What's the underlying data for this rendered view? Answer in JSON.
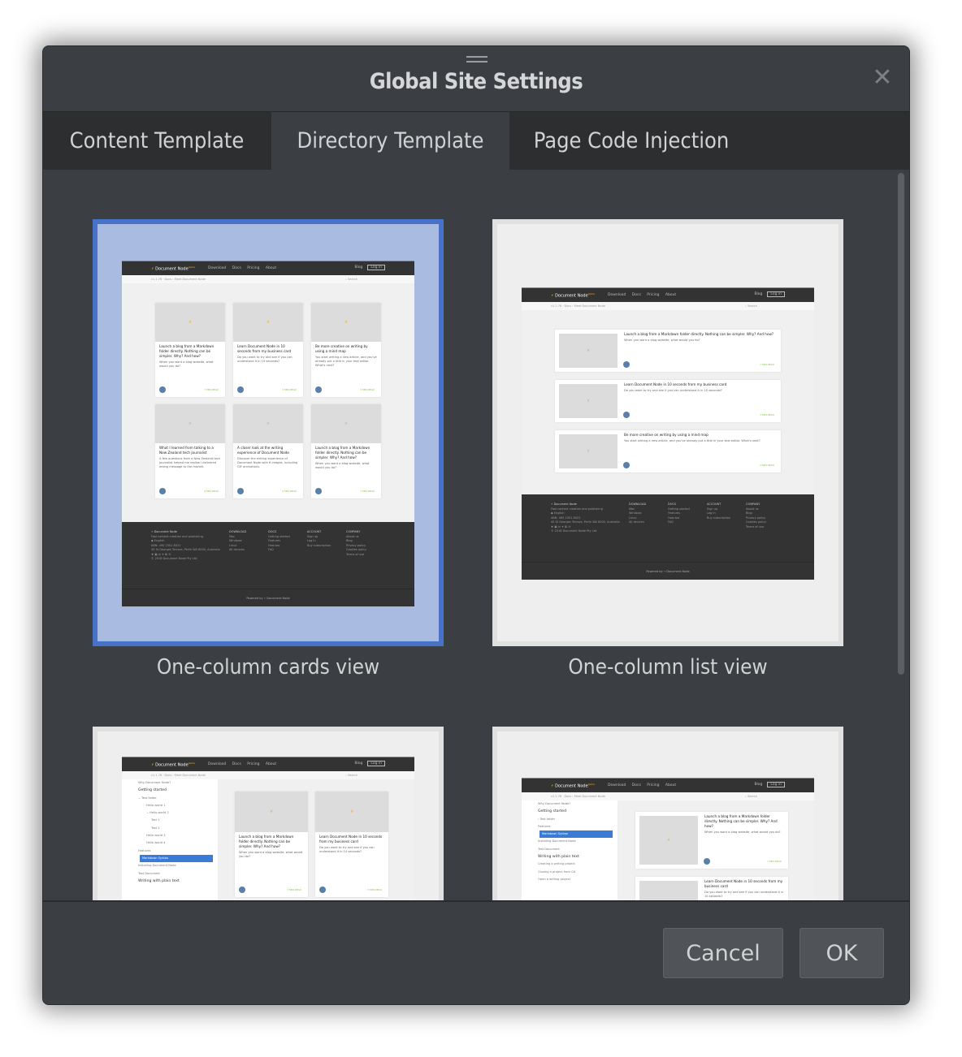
{
  "dialog": {
    "title": "Global Site Settings",
    "close_icon": "close-icon",
    "grip_icon": "drag-handle-icon"
  },
  "tabs": [
    {
      "label": "Content Template",
      "active": false
    },
    {
      "label": "Directory Template",
      "active": true
    },
    {
      "label": "Page Code Injection",
      "active": false
    }
  ],
  "templates": [
    {
      "label": "One-column cards view",
      "selected": true
    },
    {
      "label": "One-column list view",
      "selected": false
    },
    {
      "label": "",
      "selected": false
    },
    {
      "label": "",
      "selected": false
    }
  ],
  "preview": {
    "brand": "Document Node",
    "brand_badge": "alpha",
    "nav_links": [
      "Download",
      "Docs",
      "Pricing",
      "About"
    ],
    "nav_right": [
      "Blog",
      "Log in"
    ],
    "breadcrumb": "v1.1.76 · Docs › Meet Document Node",
    "search_placeholder": "Search",
    "articles": [
      {
        "title": "Launch a blog from a Markdown folder directly. Nothing can be simpler. Why? And how?",
        "desc": "When you want a blog website, what would you do?",
        "read": "7 MIN READ"
      },
      {
        "title": "Learn Document Node in 10 seconds from my business card",
        "desc": "Do you want to try and see if you can understand it in 10 seconds?",
        "read": "3 MIN READ"
      },
      {
        "title": "Be more creative on writing by using a mind map",
        "desc": "You start writing a new article, and you've already put a title in your text editor. What's next?",
        "read": "3 MIN READ"
      },
      {
        "title": "What I learned from talking to a New Zealand tech journalist",
        "desc": "A few questions from a New Zealand tech journalist helped me realize I delivered wrong message to the market.",
        "read": "4 MIN READ"
      },
      {
        "title": "A closer look at the writing experience of Document Node",
        "desc": "Discover the writing experience of Document Node with 6 images, including GIF animations.",
        "read": "2 MIN READ"
      },
      {
        "title": "Launch a blog from a Markdown folder directly. Nothing can be simpler. Why? And how?",
        "desc": "When you want a blog website, what would you do?",
        "read": "7 MIN READ"
      }
    ],
    "footer": {
      "tagline": "Fast content creation and publishing",
      "language": "English",
      "abn": "ABN: 490 2301 8022",
      "address": "45 St Georges Terrace, Perth WA 6000, Australia",
      "copyright": "© 2018 Document Node Pty Ltd",
      "columns": [
        {
          "heading": "DOWNLOAD",
          "items": [
            "Mac",
            "Windows",
            "Linux",
            "All devices"
          ]
        },
        {
          "heading": "DOCS",
          "items": [
            "Getting started",
            "Features",
            "How-tos",
            "FAQ"
          ]
        },
        {
          "heading": "ACCOUNT",
          "items": [
            "Sign up",
            "Log in",
            "Buy subscription"
          ]
        },
        {
          "heading": "COMPANY",
          "items": [
            "About us",
            "Blog",
            "Privacy policy",
            "Cookies policy",
            "Terms of use"
          ]
        }
      ],
      "powered_by": "Powered by",
      "powered_brand": "Document Node"
    },
    "sidebar": [
      {
        "text": "Why Document Node?",
        "type": "item"
      },
      {
        "text": "Getting started",
        "type": "heading"
      },
      {
        "text": "⌄ Test folder",
        "type": "item"
      },
      {
        "text": "Hello world 1",
        "type": "sub"
      },
      {
        "text": "⌄ Hello world 2",
        "type": "sub"
      },
      {
        "text": "Test 1",
        "type": "sub2"
      },
      {
        "text": "Test 2",
        "type": "sub2"
      },
      {
        "text": "Hello world 3",
        "type": "sub"
      },
      {
        "text": "Hello world 4",
        "type": "sub"
      },
      {
        "text": "Features",
        "type": "item"
      },
      {
        "text": "Markdown Syntax",
        "type": "active"
      },
      {
        "text": "Installing Document Node",
        "type": "item"
      },
      {
        "text": "Test Document",
        "type": "item"
      },
      {
        "text": "Writing with plain text",
        "type": "heading"
      }
    ],
    "sidebar_alt": [
      {
        "text": "Why Document Node?",
        "type": "item"
      },
      {
        "text": "Getting started",
        "type": "heading"
      },
      {
        "text": "› Test folder",
        "type": "item"
      },
      {
        "text": "Features",
        "type": "item"
      },
      {
        "text": "Markdown Syntax",
        "type": "active"
      },
      {
        "text": "Installing Document Node",
        "type": "item"
      },
      {
        "text": "Test Document",
        "type": "item"
      },
      {
        "text": "Writing with plain text",
        "type": "heading"
      },
      {
        "text": "Creating a writing project",
        "type": "item"
      },
      {
        "text": "Cloning a project from Git",
        "type": "item"
      },
      {
        "text": "Open a writing project",
        "type": "item"
      }
    ]
  },
  "buttons": {
    "cancel": "Cancel",
    "ok": "OK"
  },
  "colors": {
    "dialog_bg": "#3b3e42",
    "tab_bar_bg": "#2d2e30",
    "selection_border": "#4672c8",
    "selection_fill": "#a9bbe0"
  }
}
